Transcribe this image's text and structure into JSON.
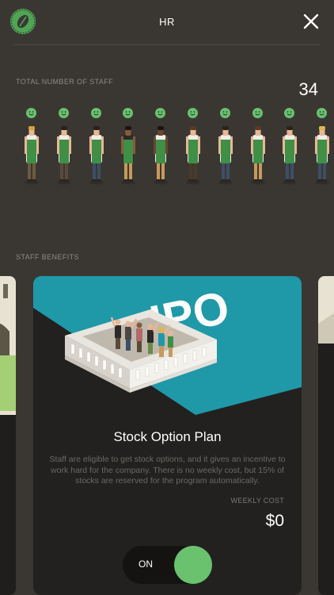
{
  "header": {
    "title": "HR"
  },
  "staff_section": {
    "label": "TOTAL NUMBER OF STAFF",
    "count": "34",
    "members": [
      {
        "skin": "#e9b796",
        "hair": "#d9a235",
        "pants": "#6d5a3c",
        "shirt": "#f0ede6"
      },
      {
        "skin": "#e9b796",
        "hair": "#2b2118",
        "pants": "#5a4a37",
        "shirt": "#f0ede6"
      },
      {
        "skin": "#e9b796",
        "hair": "#2b2118",
        "pants": "#3e4e66",
        "shirt": "#f0ede6"
      },
      {
        "skin": "#8a5a3c",
        "hair": "#1b1410",
        "pants": "#c69a5c",
        "shirt": "#2b2a28"
      },
      {
        "skin": "#6b4630",
        "hair": "#1b1410",
        "pants": "#c69a5c",
        "shirt": "#f0ede6"
      },
      {
        "skin": "#e9b796",
        "hair": "#5b3a22",
        "pants": "#4a3a2a",
        "shirt": "#f0ede6"
      },
      {
        "skin": "#e9b796",
        "hair": "#2b2118",
        "pants": "#3e4e66",
        "shirt": "#f0ede6"
      },
      {
        "skin": "#e9b796",
        "hair": "#5b3a22",
        "pants": "#c69a5c",
        "shirt": "#f0ede6"
      },
      {
        "skin": "#e9b796",
        "hair": "#2b2118",
        "pants": "#3e4e66",
        "shirt": "#f0ede6"
      },
      {
        "skin": "#e9b796",
        "hair": "#e0b64c",
        "pants": "#3e4e66",
        "shirt": "#f0ede6"
      }
    ]
  },
  "benefits_section": {
    "label": "STAFF BENEFITS"
  },
  "card": {
    "art_text": "IPO",
    "title": "Stock Option Plan",
    "description": "Staff are eligible to get stock options, and it gives an incentive to work hard for the company. There is no weekly cost, but 15% of stocks are reserved for the program automatically.",
    "cost_label": "WEEKLY COST",
    "cost_value": "$0",
    "toggle_label": "ON"
  },
  "colors": {
    "background": "#3a3733",
    "accent_green": "#6ac16e",
    "teal": "#1f98a8",
    "apron": "#3f8f46"
  },
  "icons": {
    "logo": "coffee-bean-logo",
    "close": "close-icon",
    "face": "smiley-icon"
  }
}
